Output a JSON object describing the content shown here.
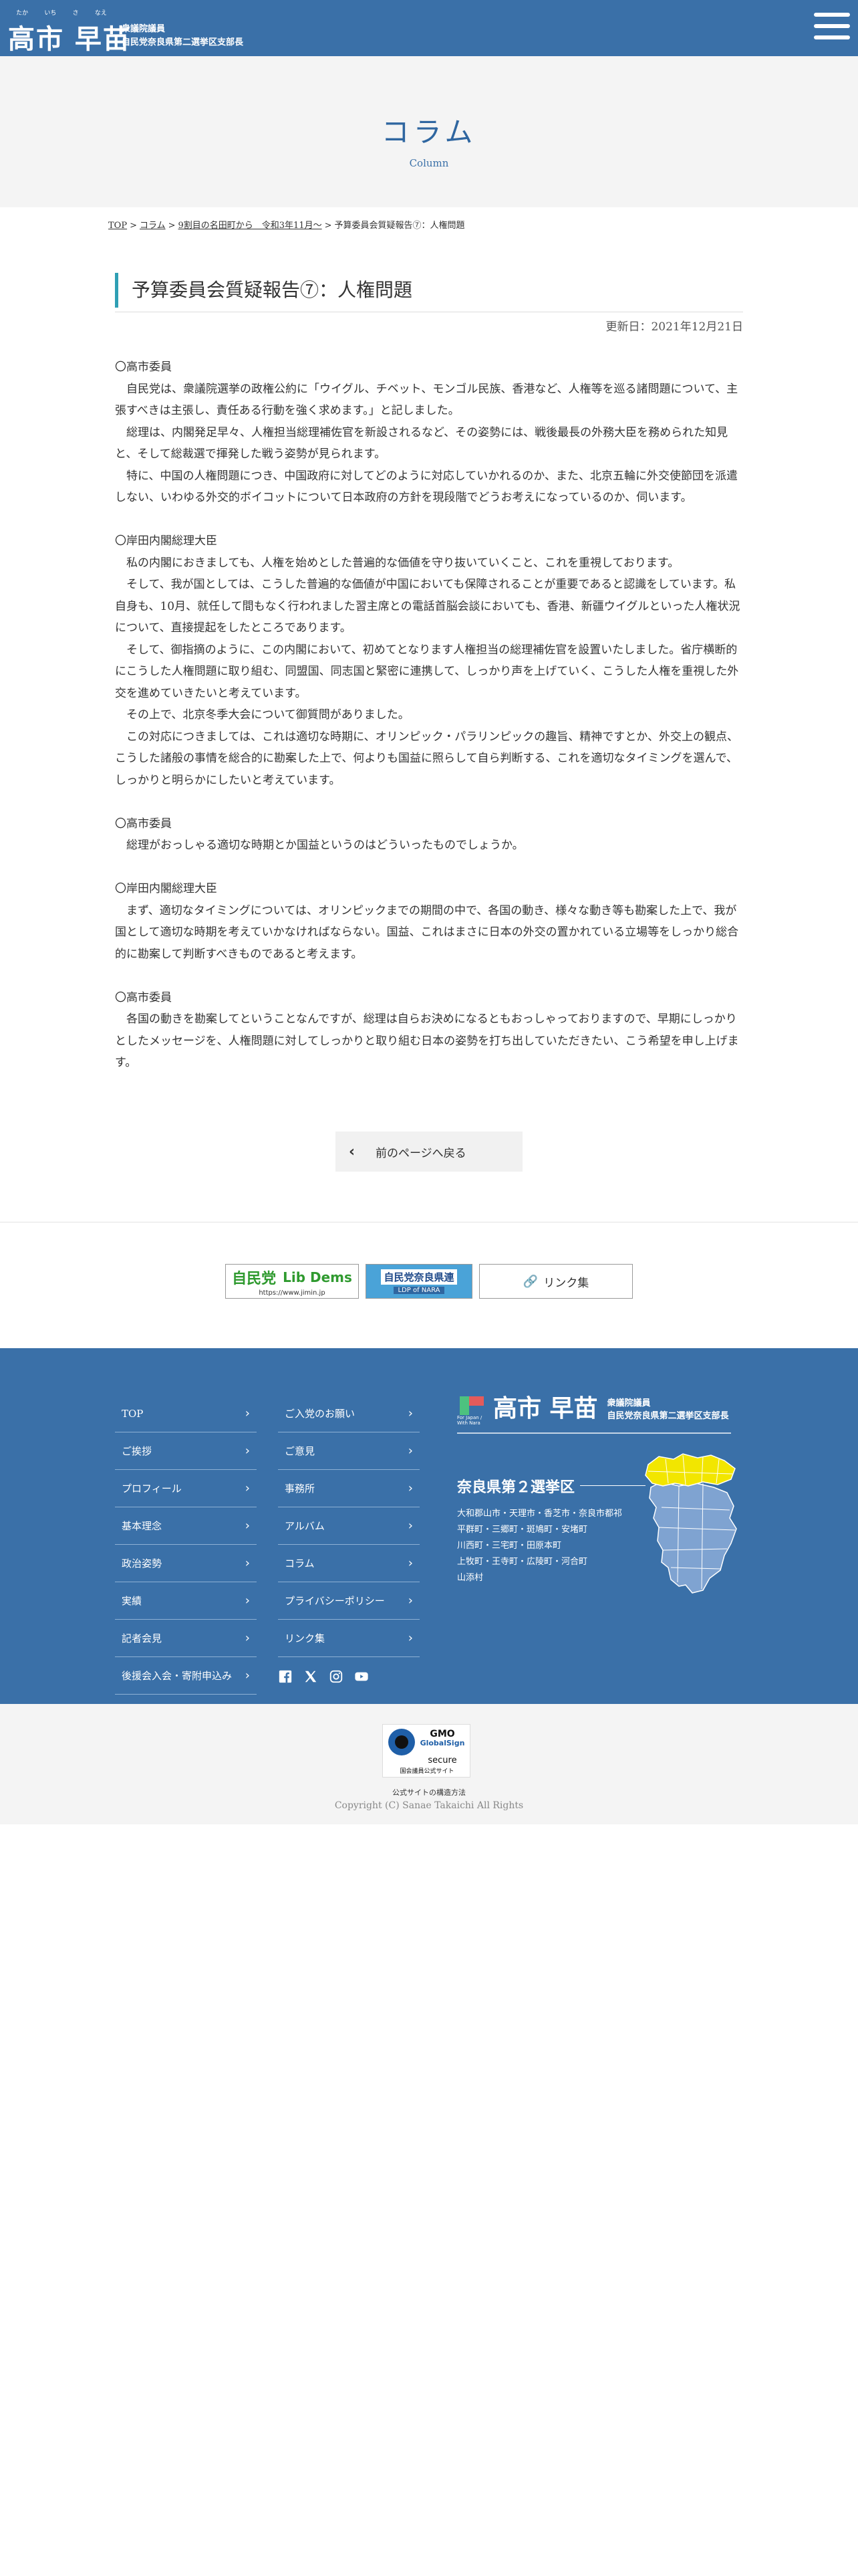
{
  "header": {
    "ruby": [
      "たか",
      "いち",
      "さ",
      "なえ"
    ],
    "name": "高市 早苗",
    "sub_line_1": "衆議院議員",
    "sub_line_2": "自民党奈良県第二選挙区支部長"
  },
  "page_heading": {
    "title": "コラム",
    "subtitle": "Column"
  },
  "breadcrumb": {
    "items": [
      "TOP",
      "コラム",
      "9割目の名田町から　令和3年11月〜",
      "予算委員会質疑報告⑦：人権問題"
    ],
    "separator": ">"
  },
  "article": {
    "title": "予算委員会質疑報告⑦：人権問題",
    "updated": "更新日：2021年12月21日",
    "sections": [
      {
        "speaker": "〇高市委員",
        "paragraphs": [
          "自民党は、衆議院選挙の政権公約に「ウイグル、チベット、モンゴル民族、香港など、人権等を巡る諸問題について、主張すべきは主張し、責任ある行動を強く求めます。」と記しました。",
          "総理は、内閣発足早々、人権担当総理補佐官を新設されるなど、その姿勢には、戦後最長の外務大臣を務められた知見と、そして総裁選で揮発した戦う姿勢が見られます。",
          "特に、中国の人権問題につき、中国政府に対してどのように対応していかれるのか、また、北京五輪に外交使節団を派遣しない、いわゆる外交的ボイコットについて日本政府の方針を現段階でどうお考えになっているのか、伺います。"
        ]
      },
      {
        "speaker": "〇岸田内閣総理大臣",
        "paragraphs": [
          "私の内閣におきましても、人権を始めとした普遍的な価値を守り抜いていくこと、これを重視しております。",
          "そして、我が国としては、こうした普遍的な価値が中国においても保障されることが重要であると認識をしています。私自身も、10月、就任して間もなく行われました習主席との電話首脳会談においても、香港、新疆ウイグルといった人権状況について、直接提起をしたところであります。",
          "そして、御指摘のように、この内閣において、初めてとなります人権担当の総理補佐官を設置いたしました。省庁横断的にこうした人権問題に取り組む、同盟国、同志国と緊密に連携して、しっかり声を上げていく、こうした人権を重視した外交を進めていきたいと考えています。",
          "その上で、北京冬季大会について御質問がありました。",
          "この対応につきましては、これは適切な時期に、オリンピック・パラリンピックの趣旨、精神ですとか、外交上の観点、こうした諸般の事情を総合的に勘案した上で、何よりも国益に照らして自ら判断する、これを適切なタイミングを選んで、しっかりと明らかにしたいと考えています。"
        ]
      },
      {
        "speaker": "〇高市委員",
        "paragraphs": [
          "総理がおっしゃる適切な時期とか国益というのはどういったものでしょうか。"
        ]
      },
      {
        "speaker": "〇岸田内閣総理大臣",
        "paragraphs": [
          "まず、適切なタイミングについては、オリンピックまでの期間の中で、各国の動き、様々な動き等も勘案した上で、我が国として適切な時期を考えていかなければならない。国益、これはまさに日本の外交の置かれている立場等をしっかり総合的に勘案して判断すべきものであると考えます。"
        ]
      },
      {
        "speaker": "〇高市委員",
        "paragraphs": [
          "各国の動きを勘案してということなんですが、総理は自らお決めになるともおっしゃっておりますので、早期にしっかりとしたメッセージを、人権問題に対してしっかりと取り組む日本の姿勢を打ち出していただきたい、こう希望を申し上げます。"
        ]
      }
    ],
    "back_label": "前のページへ戻る"
  },
  "banners": {
    "jimin_jp": "自民党",
    "jimin_en": "Lib Dems",
    "jimin_url": "https://www.jimin.jp",
    "nara_jp": "自民党奈良県連",
    "nara_en": "LDP of NARA",
    "links_label": "リンク集"
  },
  "footer": {
    "nav_col_1": [
      "TOP",
      "ご挨拶",
      "プロフィール",
      "基本理念",
      "政治姿勢",
      "実績",
      "記者会見",
      "後援会入会・寄附申込み"
    ],
    "nav_col_2": [
      "ご入党のお願い",
      "ご意見",
      "事務所",
      "アルバム",
      "コラム",
      "プライバシーポリシー",
      "リンク集"
    ],
    "brand_name": "高市 早苗",
    "brand_sub_1": "衆議院議員",
    "brand_sub_2": "自民党奈良県第二選挙区支部長",
    "brand_mark_text": "For Japan / With Nara",
    "district_title": "奈良県第２選挙区",
    "district_lines": [
      "大和郡山市・天理市・香芝市・奈良市都祁",
      "平群町・三郷町・斑鳩町・安堵町",
      "川西町・三宅町・田原本町",
      "上牧町・王寺町・広陵町・河合町",
      "山添村"
    ],
    "social_icons": [
      "facebook-icon",
      "x-icon",
      "instagram-icon",
      "youtube-icon"
    ],
    "map_highlight_color": "#f2e600",
    "map_base_color": "#7fa3d1"
  },
  "footer_bottom": {
    "seal_gmo": "GMO",
    "seal_globalsign": "GlobalSign",
    "seal_secure": "secure",
    "seal_caption": "国会議員公式サイト",
    "seal_note": "公式サイトの構造方法",
    "copyright": "Copyright (C) Sanae Takaichi All Rights"
  },
  "colors": {
    "brand_blue": "#3a70a8",
    "title_accent": "#2f9fb4",
    "heading_blue": "#2f66a0"
  }
}
